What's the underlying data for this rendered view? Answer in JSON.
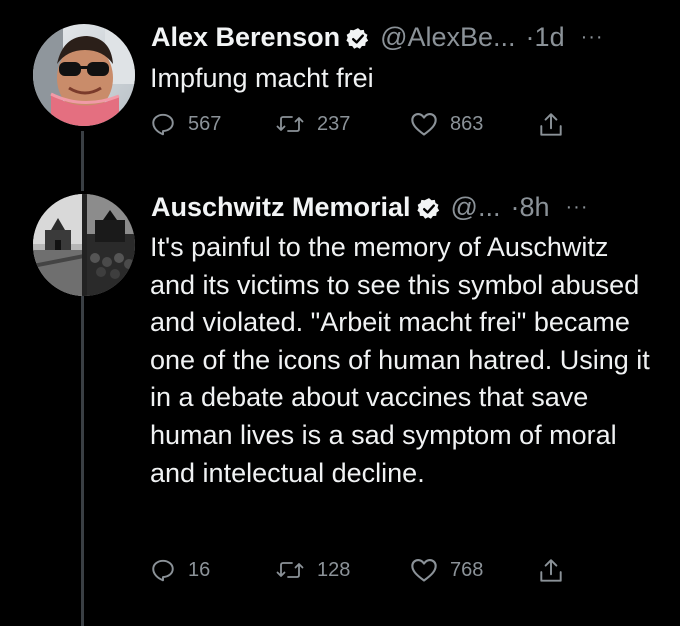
{
  "tweets": [
    {
      "author_name": "Alex Berenson",
      "handle": "@AlexBe...",
      "separator": "·",
      "time": "1d",
      "more": "···",
      "text": "Impfung macht frei",
      "replies": "567",
      "retweets": "237",
      "likes": "863"
    },
    {
      "author_name": "Auschwitz Memorial",
      "handle": "@...",
      "separator": "·",
      "time": "8h",
      "more": "···",
      "text": "It's painful  to the memory of Auschwitz and its victims to see this symbol abused and violated. \"Arbeit macht frei\" became one of the icons of human hatred. Using it in a debate about vaccines that save human lives is a sad symptom of moral and intelectual decline.",
      "replies": "16",
      "retweets": "128",
      "likes": "768"
    }
  ],
  "icons": {
    "verified": "verified-badge-icon",
    "reply": "reply-icon",
    "retweet": "retweet-icon",
    "like": "like-icon",
    "share": "share-icon",
    "more": "more-icon"
  },
  "colors": {
    "background": "#000000",
    "text": "#e7e9ea",
    "muted": "#8b9298",
    "thread_line": "#3a3f44"
  }
}
